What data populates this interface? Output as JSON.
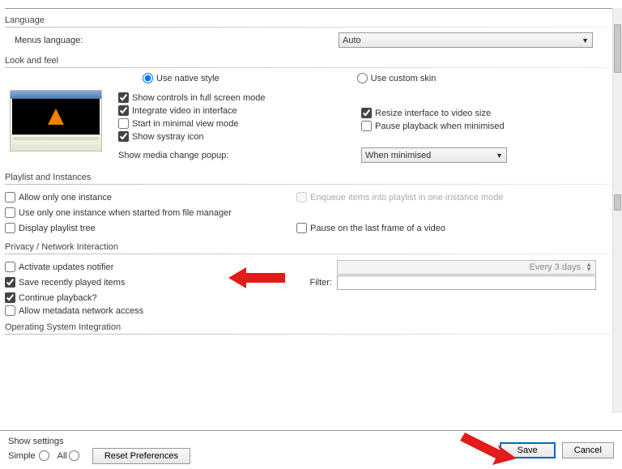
{
  "sections": {
    "language_header": "Language",
    "lookfeel_header": "Look and feel",
    "playlist_header": "Playlist and Instances",
    "privacy_header": "Privacy / Network Interaction",
    "os_header": "Operating System Integration"
  },
  "language": {
    "menus_label": "Menus language:",
    "menus_value": "Auto"
  },
  "lookfeel": {
    "native_style": "Use native style",
    "custom_skin": "Use custom skin",
    "show_controls_fs": "Show controls in full screen mode",
    "integrate_video": "Integrate video in interface",
    "resize_interface": "Resize interface to video size",
    "start_minimal": "Start in minimal view mode",
    "pause_minimised": "Pause playback when minimised",
    "show_systray": "Show systray icon",
    "media_change_label": "Show media change popup:",
    "media_change_value": "When minimised"
  },
  "playlist": {
    "allow_one": "Allow only one instance",
    "enqueue": "Enqueue items into playlist in one instance mode",
    "use_one_fm": "Use only one instance when started from file manager",
    "display_tree": "Display playlist tree",
    "pause_last": "Pause on the last frame of a video"
  },
  "privacy": {
    "activate_updates": "Activate updates notifier",
    "every_days": "Every 3 days",
    "save_recent": "Save recently played items",
    "filter_label": "Filter:",
    "continue_playback": "Continue playback?",
    "allow_metadata": "Allow metadata network access"
  },
  "footer": {
    "show_settings": "Show settings",
    "simple": "Simple",
    "all": "All",
    "reset": "Reset Preferences",
    "save": "Save",
    "cancel": "Cancel"
  }
}
